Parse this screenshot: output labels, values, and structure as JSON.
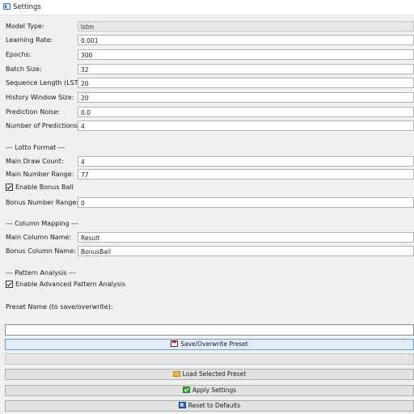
{
  "window": {
    "title": "Settings"
  },
  "model_fields": [
    {
      "label": "Model Type:",
      "value": "lstm",
      "readonly": true
    },
    {
      "label": "Learning Rate:",
      "value": "0.001"
    },
    {
      "label": "Epochs:",
      "value": "300"
    },
    {
      "label": "Batch Size:",
      "value": "32"
    },
    {
      "label": "Sequence Length (LSTM):",
      "value": "20"
    },
    {
      "label": "History Window Size:",
      "value": "20"
    },
    {
      "label": "Prediction Noise:",
      "value": "0.0"
    },
    {
      "label": "Number of Predictions:",
      "value": "4"
    }
  ],
  "lotto": {
    "header": "--- Lotto Format ---",
    "main_draw_count": {
      "label": "Main Draw Count:",
      "value": "4"
    },
    "main_number_range": {
      "label": "Main Number Range:",
      "value": "77"
    },
    "enable_bonus": {
      "label": "Enable Bonus Ball",
      "checked": true
    },
    "bonus_number_range": {
      "label": "Bonus Number Range:",
      "value": "0"
    }
  },
  "columns": {
    "header": "--- Column Mapping ---",
    "main_column": {
      "label": "Main Column Name:",
      "value": "Result"
    },
    "bonus_column": {
      "label": "Bonus Column Name:",
      "value": "BonusBall"
    }
  },
  "pattern": {
    "header": "--- Pattern Analysis ---",
    "enable_advanced": {
      "label": "Enable Advanced Pattern Analysis",
      "checked": true
    }
  },
  "preset": {
    "name_label": "Preset Name (to save/overwrite):",
    "name_value": "",
    "save_button": "Save/Overwrite Preset",
    "load_button": "Load Selected Preset"
  },
  "actions": {
    "apply_button": "Apply Settings",
    "reset_button": "Reset to Defaults"
  },
  "icons": {
    "save": "floppy-disk-icon",
    "load": "folder-icon",
    "apply": "green-check-icon",
    "reset": "reset-icon"
  }
}
